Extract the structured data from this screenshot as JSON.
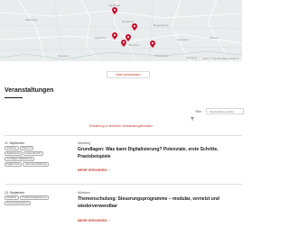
{
  "map": {
    "labels": [
      "Ingolstadt",
      "München",
      "Augsburg",
      "Nürnberg",
      "Regensburg",
      "Würzburg",
      "Passau",
      "Landshut",
      "Rosenheim",
      "Salzburg",
      "Kempten"
    ],
    "attribution": "Leaflet | © OpenStreetMap contributors",
    "reset_label": "Karte zurücksetzen",
    "colors": {
      "pin": "#c8102e",
      "background": "#e9ecec"
    }
  },
  "section": {
    "title": "Veranstaltungen"
  },
  "filter": {
    "label": "Filter",
    "search_placeholder": "Veranstaltung suchen"
  },
  "notice": "Erläuterung zu einzelnen Veranstaltungsformaten",
  "events": [
    {
      "date": "11. September",
      "tags": [
        "Workshop",
        "Digital 4.0",
        "Digitalisierung",
        "Kostenübersicht",
        "Grundlagen Digitalisierung",
        "Digitale Tools",
        "Unternehmensführung"
      ],
      "city": "Nürnberg",
      "title": "Grundlagen: Was kann Digitalisierung? Potenziale, erste Schritte, Praxisbeispiele",
      "more_label": "MEHR ERFAHREN"
    },
    {
      "date": "13. September",
      "tags": [
        "Workshop",
        "Produktionsdigitalisierung",
        "Steuerungsprogramme"
      ],
      "city": "München",
      "title": "Themenschulung: Steuerungsprogramme – modular, vernetzt und wiederverwendbar",
      "more_label": "MEHR ERFAHREN"
    }
  ]
}
